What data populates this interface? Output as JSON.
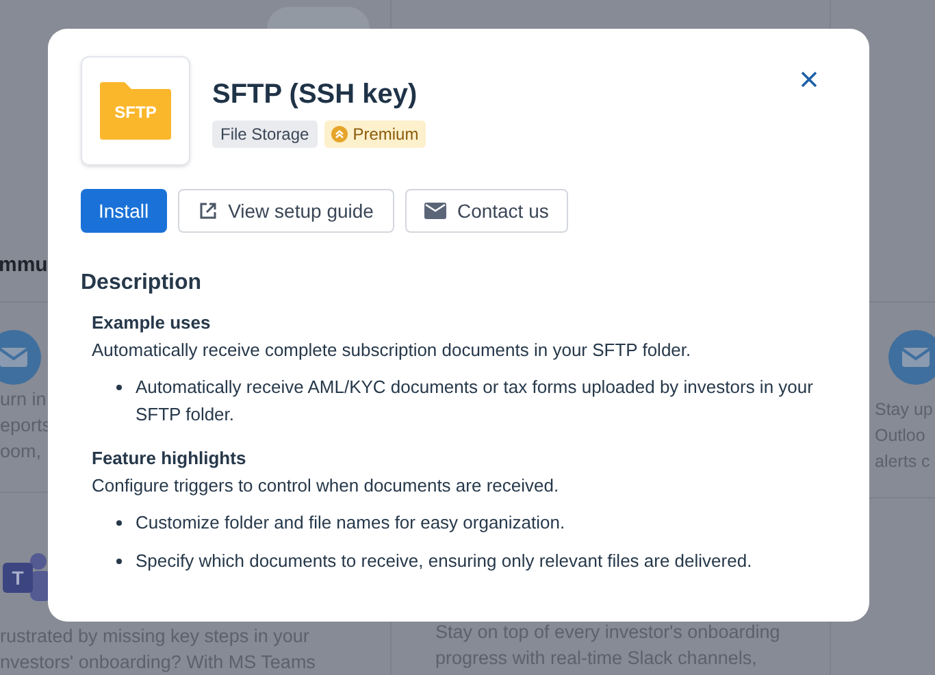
{
  "background": {
    "left_column": {
      "heading": "mmu",
      "cards": [
        {
          "kind": "mail",
          "lines": [
            "urn in",
            "eports",
            "oom,"
          ]
        },
        {
          "kind": "teams",
          "logo_letter": "T",
          "lines": [
            "rustrated by missing key steps in your",
            "nvestors' onboarding? With MS Teams"
          ]
        }
      ]
    },
    "middle_column": {
      "lines": [
        "Stay on top of every investor's onboarding",
        "progress with real-time Slack channels,"
      ]
    },
    "right_column": {
      "kind": "mail",
      "lines": [
        "Stay up",
        "Outloo",
        "alerts c"
      ]
    }
  },
  "modal": {
    "logo_text": "SFTP",
    "title": "SFTP (SSH key)",
    "badges": [
      {
        "label": "File Storage",
        "kind": "category"
      },
      {
        "label": "Premium",
        "kind": "premium"
      }
    ],
    "buttons": [
      {
        "label": "Install",
        "kind": "primary"
      },
      {
        "label": "View setup guide",
        "kind": "external"
      },
      {
        "label": "Contact us",
        "kind": "mail"
      }
    ],
    "description": {
      "heading": "Description",
      "sections": [
        {
          "heading": "Example uses",
          "text": "Automatically receive complete subscription documents in your SFTP folder.",
          "bullets": [
            "Automatically receive AML/KYC documents or tax forms uploaded by investors in your SFTP folder."
          ]
        },
        {
          "heading": "Feature highlights",
          "text": "Configure triggers to control when documents are received.",
          "bullets": [
            "Customize folder and file names for easy organization.",
            "Specify which documents to receive, ensuring only relevant files are delivered."
          ]
        }
      ]
    }
  }
}
